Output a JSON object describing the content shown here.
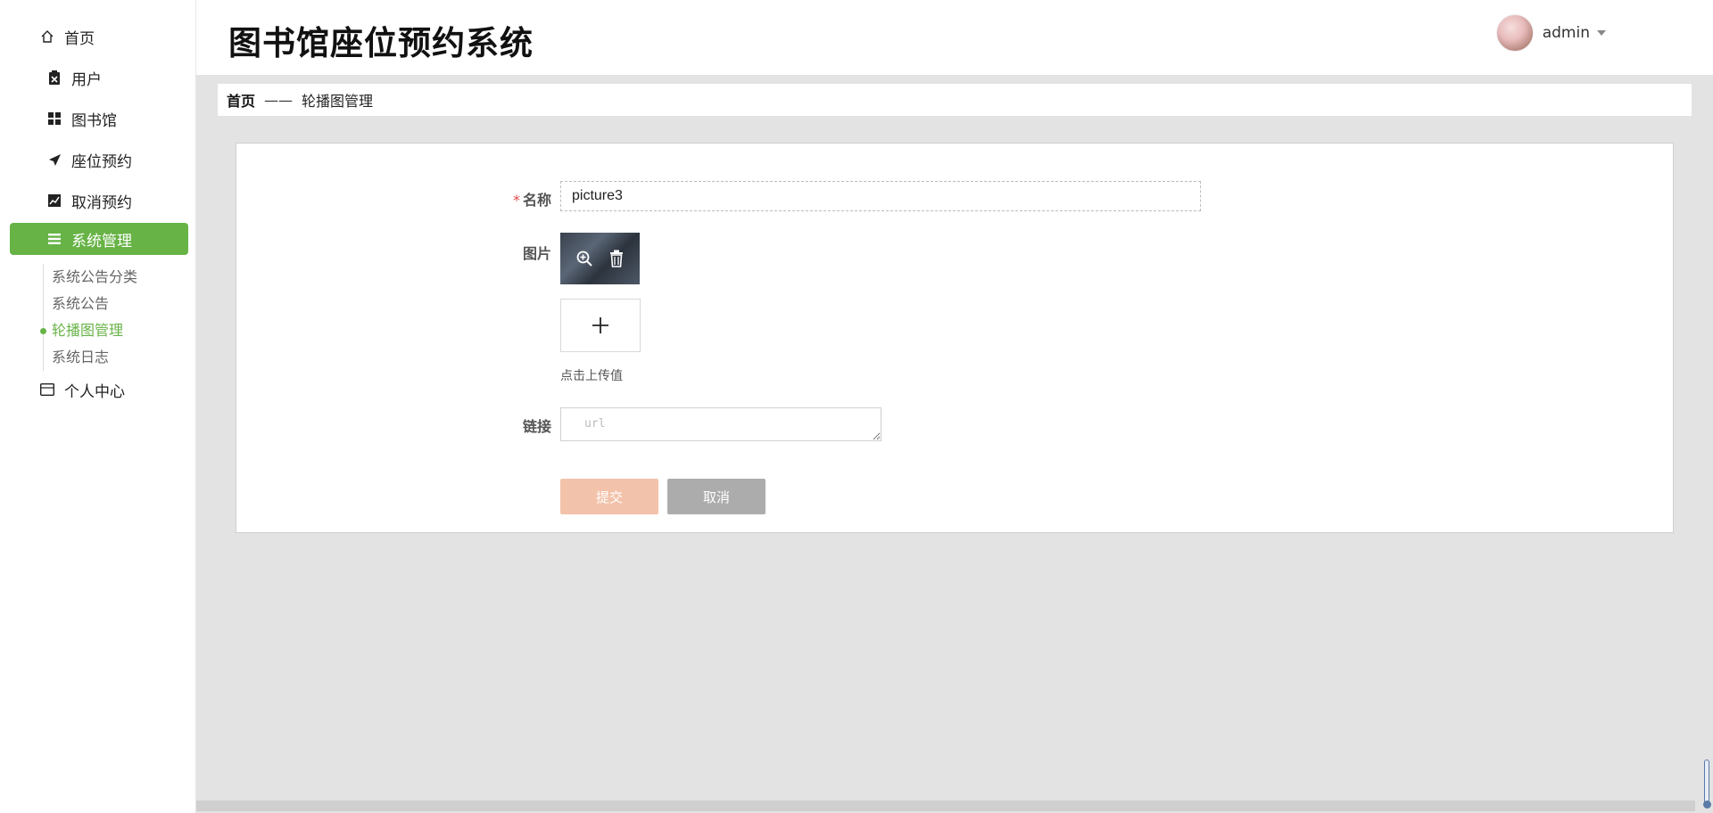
{
  "app": {
    "title": "图书馆座位预约系统"
  },
  "header": {
    "username": "admin"
  },
  "sidebar": {
    "items": [
      {
        "label": "首页",
        "icon": "home-icon"
      },
      {
        "label": "用户",
        "icon": "clipboard-icon"
      },
      {
        "label": "图书馆",
        "icon": "grid-icon"
      },
      {
        "label": "座位预约",
        "icon": "send-icon"
      },
      {
        "label": "取消预约",
        "icon": "trend-chart-icon"
      },
      {
        "label": "系统管理",
        "icon": "menu-icon",
        "active": true
      },
      {
        "label": "个人中心",
        "icon": "id-card-icon"
      }
    ],
    "submenu": [
      {
        "label": "系统公告分类"
      },
      {
        "label": "系统公告"
      },
      {
        "label": "轮播图管理",
        "active": true
      },
      {
        "label": "系统日志"
      }
    ]
  },
  "breadcrumb": {
    "home": "首页",
    "separator": "——",
    "current": "轮播图管理"
  },
  "form": {
    "name_label": "名称",
    "name_required_mark": "*",
    "name_value": "picture3",
    "image_label": "图片",
    "upload_tip": "点击上传值",
    "link_label": "链接",
    "link_placeholder": "url",
    "submit_label": "提交",
    "cancel_label": "取消"
  },
  "colors": {
    "accent": "#67b346",
    "submit_button": "#f3c2aa",
    "cancel_button": "#acacac",
    "required": "#e24c4c"
  }
}
